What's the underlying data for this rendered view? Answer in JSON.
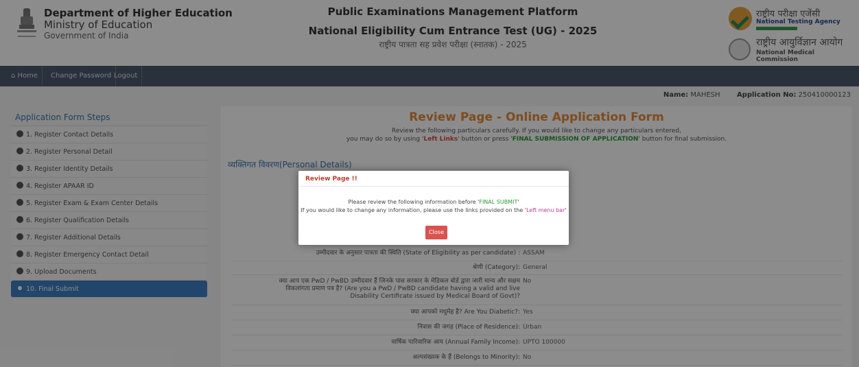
{
  "header": {
    "dept_line1": "Department of Higher Education",
    "dept_line2": "Ministry of Education",
    "dept_line3": "Government of India",
    "platform": "Public Examinations Management Platform",
    "exam_title": "National Eligibility Cum Entrance Test (UG) - 2025",
    "exam_title_hindi": "राष्ट्रीय पात्रता सह प्रवेश परीक्षा (स्नातक) - 2025",
    "nta_hindi": "राष्ट्रीय परीक्षा एजेंसी",
    "nta_english": "National Testing Agency",
    "nmc_hindi": "राष्ट्रीय आयुर्विज्ञान आयोग",
    "nmc_english": "National Medical Commission"
  },
  "navbar": {
    "home": "Home",
    "change_password": "Change Password",
    "logout": "Logout"
  },
  "info": {
    "name_label": "Name:",
    "name_value": "MAHESH",
    "app_label": "Application No:",
    "app_value": "250410000123"
  },
  "sidebar": {
    "title": "Application Form Steps",
    "steps": [
      "1. Register Contact Details",
      "2. Register Personal Detail",
      "3. Register Identity Details",
      "4. Register APAAR ID",
      "5. Register Exam & Exam Center Details",
      "6. Register Qualification Details",
      "7. Register Additional Details",
      "8. Register Emergency Contact Detail",
      "9. Upload Documents",
      "10. Final Submit"
    ]
  },
  "main": {
    "title": "Review Page - Online Application Form",
    "desc_line1": "Review the following particulars carefully. If you would like to change any particulars entered,",
    "desc_line2_a": "you may do so by using '",
    "desc_left_links": "Left Links",
    "desc_line2_b": "' button or press '",
    "desc_final": "FINAL SUBMISSION OF APPLICATION",
    "desc_line2_c": "' button for final submission.",
    "section": "व्यक्तिगत विवरण(Personal Details)",
    "rows": [
      {
        "label": "उम्मीदवार के अनुसार पात्रता की स्थिति (State of Eligibility as per candidate) :",
        "value": "ASSAM"
      },
      {
        "label": "श्रेणी (Category):",
        "value": "General"
      },
      {
        "label": "क्या आप एक PwD / PwBD उम्मीदवार हैं जिनके पास सरकार के मेडिकल बोर्ड द्वारा जारी मान्य और सक्षम विकलांगता प्रमाण पत्र है? (Are you a PwD / PwBD candidate having a valid and live Disability Certificate issued by Medical Board of Govt)?",
        "value": "No"
      },
      {
        "label": "क्या आपको मधुमेह है? Are You Diabetic?:",
        "value": "Yes"
      },
      {
        "label": "निवास की जगह (Place of Residence):",
        "value": "Urban"
      },
      {
        "label": "वार्षिक पारिवारिक आय (Annual Family Income):",
        "value": "UPTO 100000"
      },
      {
        "label": "अल्पसंख्यक के हैं (Belongs to Minority):",
        "value": "No"
      }
    ]
  },
  "modal": {
    "title": "Review Page !!",
    "line1_a": "Please review the following information before '",
    "line1_hl": "FINAL SUBMIT",
    "line1_b": "'",
    "line2_a": "If you would like to change any information, please use the links provided on the '",
    "line2_hl": "Left menu bar",
    "line2_b": "'",
    "close_label": "Close"
  }
}
